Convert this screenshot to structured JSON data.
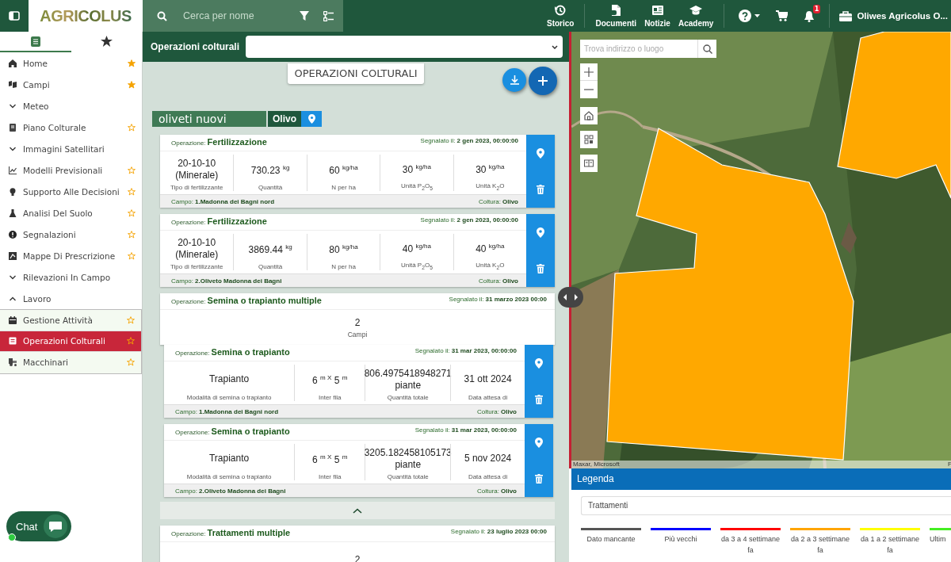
{
  "topbar": {
    "logo": "AGRICOLUS",
    "search": {
      "placeholder": "Cerca per nome"
    },
    "nav": [
      {
        "label": "Storico"
      },
      {
        "label": "Documenti"
      },
      {
        "label": "Notizie"
      },
      {
        "label": "Academy"
      }
    ],
    "notifications": "1",
    "account": "Oliwes Agricolus O..."
  },
  "sidebar": {
    "tabs": [
      {
        "selected": true
      },
      {
        "selected": false
      }
    ],
    "items": [
      {
        "kind": "link",
        "label": "Home",
        "favorite": true,
        "selected": false
      },
      {
        "kind": "link",
        "label": "Campi",
        "favorite": true,
        "selected": false
      },
      {
        "kind": "group",
        "label": "Meteo",
        "expanded": false
      },
      {
        "kind": "link",
        "label": "Piano Colturale",
        "favorite": false,
        "selected": false
      },
      {
        "kind": "group",
        "label": "Immagini Satellitari",
        "expanded": false
      },
      {
        "kind": "link",
        "label": "Modelli Previsionali",
        "favorite": false,
        "selected": false
      },
      {
        "kind": "link",
        "label": "Supporto Alle Decisioni",
        "favorite": false,
        "selected": false
      },
      {
        "kind": "link",
        "label": "Analisi Del Suolo",
        "favorite": false,
        "selected": false
      },
      {
        "kind": "link",
        "label": "Segnalazioni",
        "favorite": false,
        "selected": false
      },
      {
        "kind": "link",
        "label": "Mappe Di Prescrizione",
        "favorite": false,
        "selected": false
      },
      {
        "kind": "group",
        "label": "Rilevazioni In Campo",
        "expanded": false
      },
      {
        "kind": "group",
        "label": "Lavoro",
        "expanded": true,
        "children": [
          {
            "kind": "link",
            "label": "Gestione Attività",
            "favorite": false,
            "selected": false
          },
          {
            "kind": "link",
            "label": "Operazioni Colturali",
            "favorite": false,
            "selected": true
          },
          {
            "kind": "link",
            "label": "Macchinari",
            "favorite": false,
            "selected": false
          }
        ]
      }
    ]
  },
  "chat": {
    "label": "Chat",
    "online": true
  },
  "main": {
    "header_label": "Operazioni colturali",
    "title": "OPERAZIONI COLTURALI",
    "group": {
      "name": "oliveti nuovi",
      "crop": "Olivo"
    },
    "operations": [
      {
        "kind": "single",
        "label": "Operazione:",
        "name": "Fertilizzazione",
        "reported_label": "Segnalato il:",
        "reported": "2 gen 2023, 00:00:00",
        "metrics": [
          {
            "value": "20-10-10 (Minerale)",
            "caption": "Tipo di fertilizzante"
          },
          {
            "value": "730.23 $^{kg}$",
            "caption": "Quantità"
          },
          {
            "value": "60 $^{kg/ha}$",
            "caption": "N per ha"
          },
          {
            "value": "30 $^{kg/ha}$",
            "caption": "Unità P$_{2}$O$_{5}$"
          },
          {
            "value": "30 $^{kg/ha}$",
            "caption": "Unità K$_{2}$O"
          }
        ],
        "field_label": "Campo:",
        "field": "1.Madonna dei Bagni nord",
        "crop_label": "Coltura:",
        "crop": "Olivo"
      },
      {
        "kind": "single",
        "label": "Operazione:",
        "name": "Fertilizzazione",
        "reported_label": "Segnalato il:",
        "reported": "2 gen 2023, 00:00:00",
        "metrics": [
          {
            "value": "20-10-10 (Minerale)",
            "caption": "Tipo di fertilizzante"
          },
          {
            "value": "3869.44 $^{kg}$",
            "caption": "Quantità"
          },
          {
            "value": "80 $^{kg/ha}$",
            "caption": "N per ha"
          },
          {
            "value": "40 $^{kg/ha}$",
            "caption": "Unità P$_{2}$O$_{5}$"
          },
          {
            "value": "40 $^{kg/ha}$",
            "caption": "Unità K$_{2}$O"
          }
        ],
        "field_label": "Campo:",
        "field": "2.Oliveto Madonna dei Bagni",
        "crop_label": "Coltura:",
        "crop": "Olivo"
      },
      {
        "kind": "multiple",
        "label": "Operazione:",
        "name": "Semina o trapianto multiple",
        "reported_label": "Segnalato il:",
        "reported": "31 marzo 2023 00:00",
        "count": "2",
        "count_label": "Campi",
        "expanded": true,
        "children": [
          {
            "kind": "single",
            "label": "Operazione:",
            "name": "Semina o trapianto",
            "reported_label": "Segnalato il:",
            "reported": "31 mar 2023, 00:00:00",
            "metrics": [
              {
                "value": "Trapianto",
                "caption": "Modalità di semina o trapianto"
              },
              {
                "value": "6 $^{m X}$ 5 $^{m}$",
                "caption": "Inter fila"
              },
              {
                "value": "806.4975418948271 piante",
                "caption": "Quantità totale"
              },
              {
                "value": "31 ott 2024",
                "caption": "Data attesa di"
              }
            ],
            "field_label": "Campo:",
            "field": "1.Madonna dei Bagni nord",
            "crop_label": "Coltura:",
            "crop": "Olivo"
          },
          {
            "kind": "single",
            "label": "Operazione:",
            "name": "Semina o trapianto",
            "reported_label": "Segnalato il:",
            "reported": "31 mar 2023, 00:00:00",
            "metrics": [
              {
                "value": "Trapianto",
                "caption": "Modalità di semina o trapianto"
              },
              {
                "value": "6 $^{m X}$ 5 $^{m}$",
                "caption": "Inter fila"
              },
              {
                "value": "3205.182458105173 piante",
                "caption": "Quantità totale"
              },
              {
                "value": "5 nov 2024",
                "caption": "Data attesa di"
              }
            ],
            "field_label": "Campo:",
            "field": "2.Oliveto Madonna dei Bagni",
            "crop_label": "Coltura:",
            "crop": "Olivo"
          }
        ]
      },
      {
        "kind": "multiple",
        "label": "Operazione:",
        "name": "Trattamenti multiple",
        "reported_label": "Segnalato il:",
        "reported": "23 luglio 2023 00:00",
        "count": "2"
      }
    ]
  },
  "map": {
    "search": {
      "placeholder": "Trova indirizzo o luogo"
    },
    "attribution": "Maxar, Microsoft",
    "attribution_right": "F"
  },
  "legend": {
    "title": "Legenda",
    "layer": "Trattamenti",
    "items": [
      {
        "label": "Dato mancante",
        "color": "#555555"
      },
      {
        "label": "Più vecchi",
        "color": "#0000ff"
      },
      {
        "label": "da 3 a 4 settimane fa",
        "color": "#ff0000"
      },
      {
        "label": "da 2 a 3 settimane fa",
        "color": "#ffa500"
      },
      {
        "label": "da 1 a 2 settimane fa",
        "color": "#ffff00"
      },
      {
        "label": "Ultim",
        "color": "#44ee22"
      }
    ]
  }
}
